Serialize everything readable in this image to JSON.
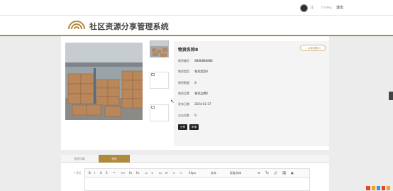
{
  "topbar": {
    "username": "11",
    "center_label": "个人中心",
    "logout_label": "退出"
  },
  "header": {
    "title": "社区资源分享管理系统",
    "brand_color": "#b08a3c"
  },
  "resource": {
    "name": "物资名称8",
    "favorite_label": "☆ 点我收藏(0)",
    "fields": [
      {
        "label": "物资编号",
        "value": "8888888888"
      },
      {
        "label": "物资类型",
        "value": "物资类型8"
      },
      {
        "label": "物资数量",
        "value": "8"
      },
      {
        "label": "物资品牌",
        "value": "物资品牌8"
      },
      {
        "label": "发布日期",
        "value": "2024-02-27"
      },
      {
        "label": "点击次数",
        "value": "9"
      }
    ],
    "share_label": "分享",
    "apply_label": "申请"
  },
  "tabs": {
    "detail_label": "物资详情",
    "review_label": "评论"
  },
  "editor": {
    "label": "评论",
    "required_mark": "*",
    "toolbar": [
      "B",
      "I",
      "U",
      "S",
      "❝",
      "<>",
      "H₁",
      "H₂",
      "≔",
      "≡",
      "x₂",
      "x²",
      "⇤",
      "⇥",
      "14px",
      "文本",
      "标准字体",
      "☰",
      "Tx",
      "🔗",
      "🖼",
      "▣"
    ]
  }
}
